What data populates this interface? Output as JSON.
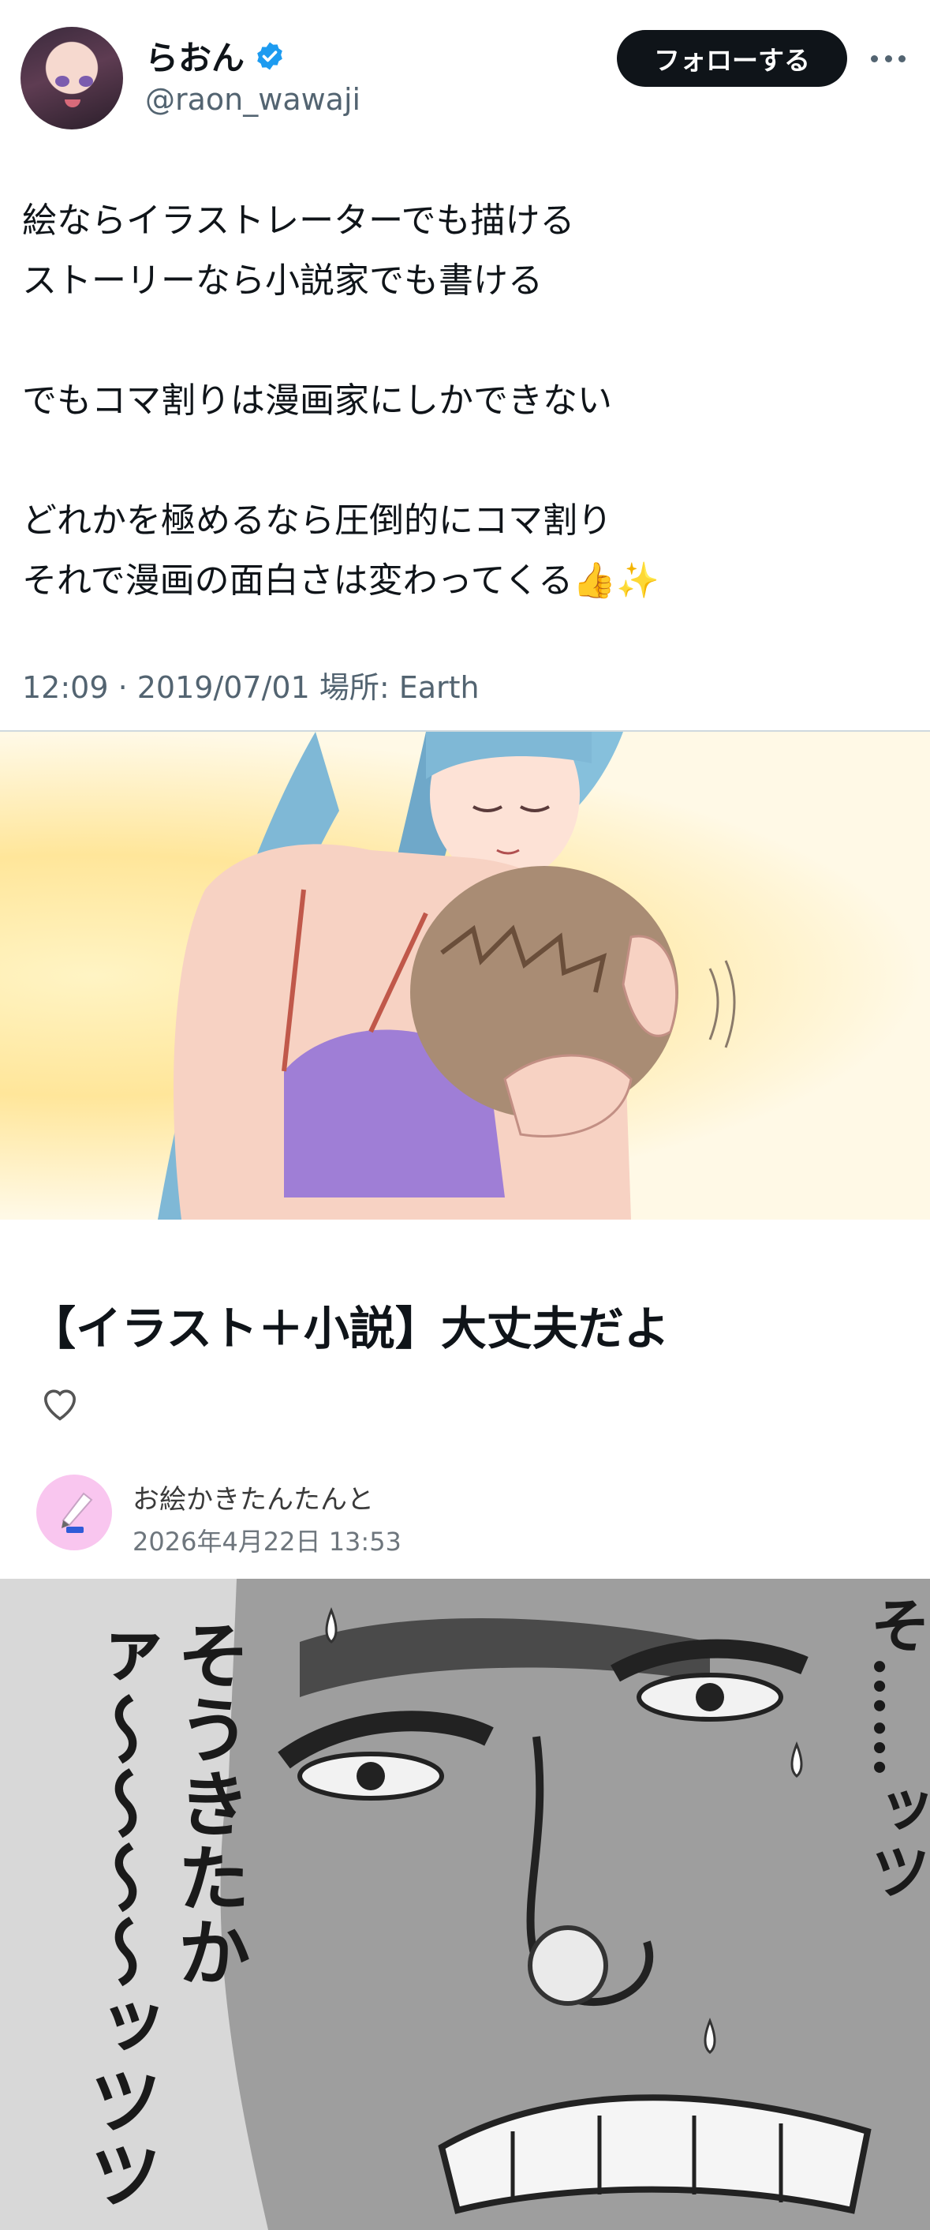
{
  "user": {
    "display_name": "らおん",
    "handle": "@raon_wawaji",
    "verified_icon": "verified-badge-icon",
    "follow_label": "フォローする"
  },
  "tweet": {
    "text": "絵ならイラストレーターでも描ける\nストーリーなら小説家でも書ける\n\nでもコマ割りは漫画家にしかできない\n\nどれかを極めるなら圧倒的にコマ割り\nそれで漫画の面白さは変わってくる👍✨",
    "meta": "12:09 · 2019/07/01 場所: Earth"
  },
  "card": {
    "title": "【イラスト＋小説】大丈夫だよ",
    "author_name": "お絵かきたんたんと",
    "author_date": "2026年4月22日 13:53"
  },
  "manga": {
    "left_caption": "そうきたかァ〜〜〜〜ッツツ",
    "right_caption": "そ……ッツ"
  },
  "colors": {
    "accent": "#0f1419",
    "verified": "#1d9bf0",
    "secondary_text": "#536471"
  }
}
